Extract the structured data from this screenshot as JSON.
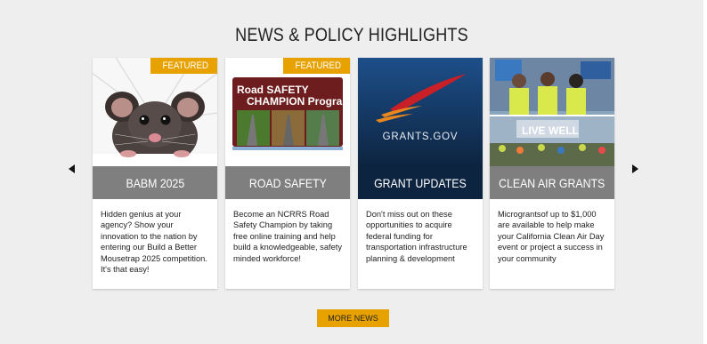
{
  "section": {
    "title": "NEWS & POLICY HIGHLIGHTS"
  },
  "cards": [
    {
      "badge": "FEATURED",
      "label": "BABM 2025",
      "band_color": "#7f7f7f",
      "text": "Hidden genius at your agency? Show your innovation to the nation by entering our Build a Better Mousetrap 2025 competition. It's that easy!"
    },
    {
      "badge": "FEATURED",
      "label": "ROAD SAFETY",
      "band_color": "#7f7f7f",
      "sign_line1": "Road SAFETY",
      "sign_line2": "CHAMPION Program",
      "text": "Become an NCRRS Road Safety Champion by taking free online training and help build a knowledgeable, safety minded workforce!"
    },
    {
      "label": "GRANT UPDATES",
      "band_color": "#0d2440",
      "logo_text": "GRANTS.GOV",
      "text": "Don't miss out on these opportunities to acquire federal funding for transportation infrastructure planning & development"
    },
    {
      "label": "CLEAN AIR GRANTS",
      "band_color": "#7f7f7f",
      "sign_text": "LIVE WELL",
      "text": "Micrograntsof up to $1,000 are available to help make your California Clean Air Day event or project a success in your community"
    }
  ],
  "more_button": {
    "label": "MORE NEWS"
  },
  "colors": {
    "accent": "#e8a200",
    "section_bg": "#eeeeee"
  },
  "icons": {
    "prev": "triangle-left-icon",
    "next": "triangle-right-icon"
  }
}
